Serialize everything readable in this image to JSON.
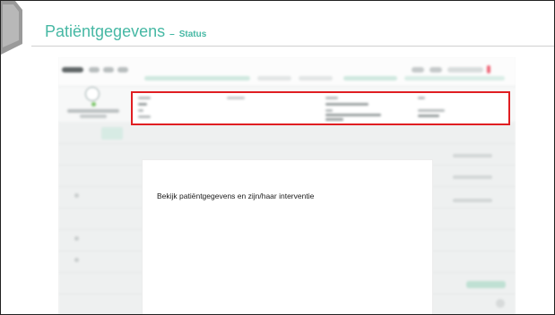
{
  "slide": {
    "title": "Patiëntgegevens",
    "separator": "–",
    "subtitle": "Status",
    "accent_color": "#46b8a4",
    "highlight_color": "#e01e22"
  },
  "callout": {
    "text": "Bekijk patiëntgegevens en zijn/haar interventie"
  },
  "icons": [
    "folder-tab-icon",
    "avatar-icon",
    "status-dot-icon"
  ]
}
